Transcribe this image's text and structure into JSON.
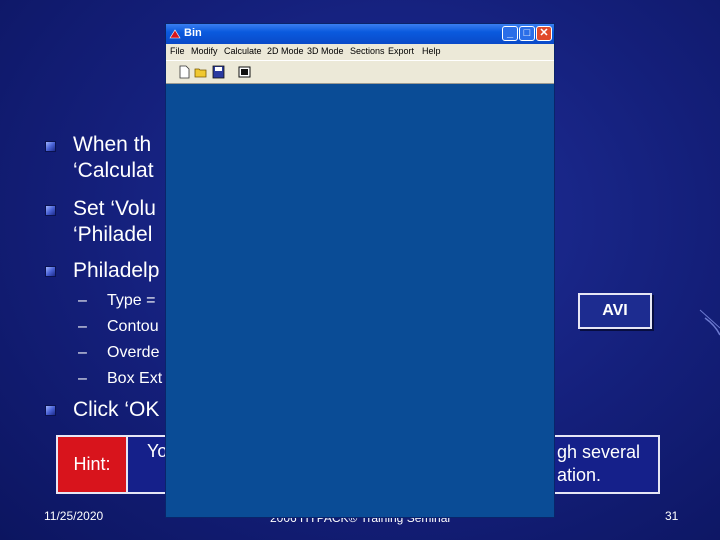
{
  "slide": {
    "bullets": [
      "When th",
      "‘Calculat",
      "Set ‘Volu",
      "‘Philadel",
      "Philadelp"
    ],
    "sub_bullets": [
      {
        "dash": "–",
        "text": "Type ="
      },
      {
        "dash": "–",
        "text": "Contou"
      },
      {
        "dash": "–",
        "text": "Overde"
      },
      {
        "dash": "–",
        "text": "Box Ext"
      }
    ],
    "click_ok": "Click ‘OK",
    "avi_label": "AVI",
    "hint": {
      "label": "Hint:",
      "text_left": "Yo",
      "text_right_1": "gh several",
      "text_right_2": "ation."
    },
    "footer": {
      "date": "11/25/2020",
      "center": "2006 HYPACK® Training Seminar",
      "page": "31"
    }
  },
  "window": {
    "title": "Bin",
    "controls": {
      "minimize": "_",
      "maximize": "□",
      "close": "✕"
    },
    "menu": [
      "File",
      "Modify",
      "Calculate",
      "2D Mode",
      "3D Mode",
      "Sections",
      "Export",
      "Help"
    ],
    "toolbar_icons": [
      "new-file-icon",
      "open-folder-icon",
      "save-icon",
      "print-icon"
    ],
    "colors": {
      "canvas": "#0a4c96",
      "titlebar": "#0a5ade"
    }
  }
}
